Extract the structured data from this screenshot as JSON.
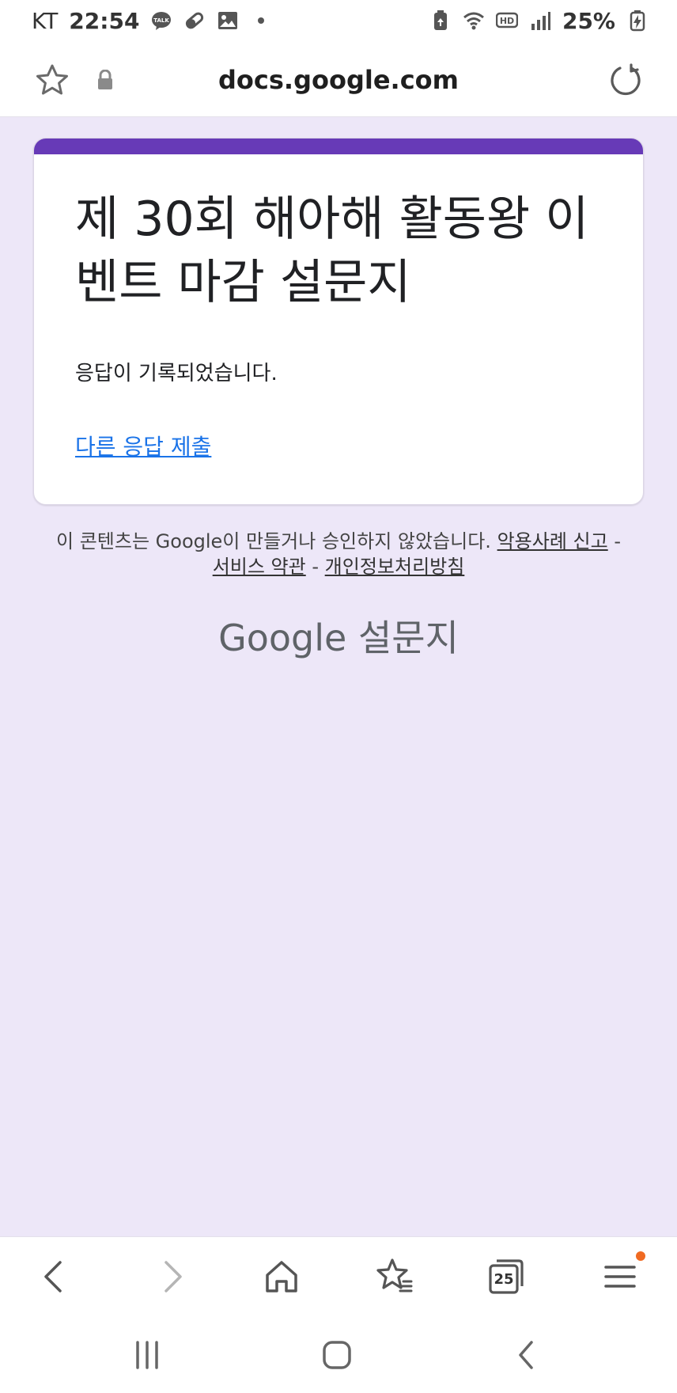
{
  "status_bar": {
    "carrier": "KT",
    "time": "22:54",
    "battery": "25%",
    "left_icons": [
      "kakaotalk-icon",
      "pill-icon",
      "gallery-icon",
      "dot-icon"
    ],
    "right_icons": [
      "battery-saver-icon",
      "wifi-icon",
      "hd-icon",
      "signal-icon",
      "battery-charging-icon"
    ]
  },
  "address_bar": {
    "url": "docs.google.com",
    "icons": [
      "star-icon",
      "lock-icon",
      "reload-icon"
    ]
  },
  "form": {
    "title": "제 30회 해아해 활동왕 이벤트 마감 설문지",
    "message": "응답이 기록되었습니다.",
    "link": "다른 응답 제출",
    "accent_color": "#673ab7"
  },
  "footer": {
    "disclaimer": "이 콘텐츠는 Google이 만들거나 승인하지 않았습니다.",
    "links": [
      "악용사례 신고",
      "서비스 약관",
      "개인정보처리방침"
    ],
    "separator": "-",
    "brand_google": "Google",
    "brand_forms": "설문지"
  },
  "toolbar": {
    "icons": [
      "back-icon",
      "forward-icon",
      "home-icon",
      "bookmarks-icon",
      "tabs-icon",
      "menu-icon"
    ],
    "tabs_count": "25"
  },
  "system_nav": {
    "icons": [
      "recents-icon",
      "home-nav-icon",
      "back-nav-icon"
    ]
  }
}
